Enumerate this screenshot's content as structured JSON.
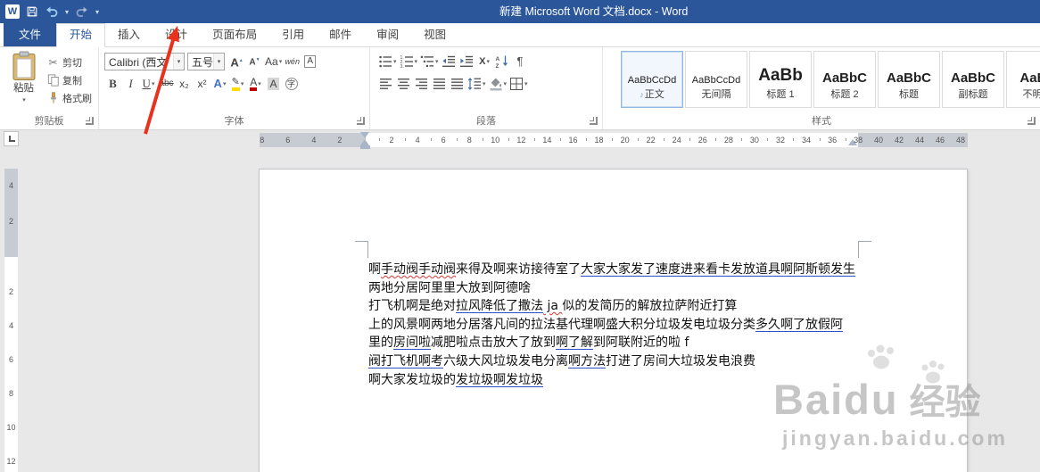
{
  "titlebar": {
    "title": "新建 Microsoft Word 文档.docx - Word"
  },
  "icons": {
    "dropdown": "▾",
    "word_logo": "W"
  },
  "tabs": [
    {
      "id": "file",
      "label": "文件"
    },
    {
      "id": "home",
      "label": "开始",
      "active": true
    },
    {
      "id": "insert",
      "label": "插入"
    },
    {
      "id": "design",
      "label": "设计"
    },
    {
      "id": "page-layout",
      "label": "页面布局"
    },
    {
      "id": "references",
      "label": "引用"
    },
    {
      "id": "mailings",
      "label": "邮件"
    },
    {
      "id": "review",
      "label": "审阅"
    },
    {
      "id": "view",
      "label": "视图"
    }
  ],
  "ribbon": {
    "clipboard": {
      "group_label": "剪贴板",
      "paste_label": "粘贴",
      "buttons": [
        {
          "id": "cut",
          "label": "剪切",
          "glyph": "✂"
        },
        {
          "id": "copy",
          "label": "复制",
          "icon": "copy"
        },
        {
          "id": "format-painter",
          "label": "格式刷",
          "icon": "painter"
        }
      ]
    },
    "font": {
      "group_label": "字体",
      "font_name": "Calibri (西文",
      "font_size": "五号",
      "row1_buttons": [
        {
          "name": "grow-font",
          "glyph": "A",
          "cls": "grow"
        },
        {
          "name": "shrink-font",
          "glyph": "A",
          "cls": "shrink"
        },
        {
          "name": "change-case",
          "glyph": "Aa",
          "dropdown": true
        },
        {
          "name": "phonetic-guide",
          "glyph": "wén",
          "cls": "phon"
        },
        {
          "name": "character-border",
          "glyph": "A",
          "cls": "cborder"
        }
      ],
      "row2_buttons": [
        {
          "name": "bold",
          "glyph": "B",
          "cls": "b"
        },
        {
          "name": "italic",
          "glyph": "I",
          "cls": "i"
        },
        {
          "name": "underline",
          "glyph": "U",
          "cls": "u",
          "dropdown": true
        },
        {
          "name": "strikethrough",
          "glyph": "abc",
          "cls": "strike"
        },
        {
          "name": "subscript",
          "glyph": "x₂"
        },
        {
          "name": "superscript",
          "glyph": "x²"
        },
        {
          "name": "text-effects",
          "glyph": "A",
          "cls": "fx",
          "dropdown": true
        },
        {
          "name": "text-highlight-color",
          "glyph": "✎",
          "cls": "hl",
          "dropdown": true
        },
        {
          "name": "font-color",
          "glyph": "A",
          "cls": "fc",
          "dropdown": true
        },
        {
          "name": "character-shading",
          "glyph": "A",
          "cls": "cshade"
        },
        {
          "name": "enclose-characters",
          "glyph": "字",
          "cls": "enc"
        }
      ]
    },
    "paragraph": {
      "group_label": "段落",
      "row1_buttons": [
        {
          "name": "bullets",
          "icon": "bullets",
          "dropdown": true
        },
        {
          "name": "numbering",
          "icon": "numbering",
          "dropdown": true
        },
        {
          "name": "multilevel-list",
          "icon": "multilevel",
          "dropdown": true
        },
        {
          "name": "decrease-indent",
          "icon": "outdent"
        },
        {
          "name": "increase-indent",
          "icon": "indent"
        },
        {
          "name": "asian-layout",
          "glyph": "X",
          "cls": "asian",
          "dropdown": true
        },
        {
          "name": "sort",
          "icon": "sort"
        },
        {
          "name": "show-formatting-marks",
          "glyph": "¶",
          "cls": "pil"
        }
      ],
      "row2_buttons": [
        {
          "name": "align-left",
          "icon": "alignL"
        },
        {
          "name": "align-center",
          "icon": "alignC"
        },
        {
          "name": "align-right",
          "icon": "alignR"
        },
        {
          "name": "justify",
          "icon": "alignJ"
        },
        {
          "name": "distribute",
          "icon": "alignD"
        },
        {
          "name": "line-spacing",
          "icon": "linespace",
          "dropdown": true
        },
        {
          "name": "shading",
          "icon": "shading",
          "dropdown": true
        },
        {
          "name": "borders",
          "icon": "borders",
          "dropdown": true
        }
      ]
    },
    "styles": {
      "group_label": "样式",
      "gallery": [
        {
          "preview": "AaBbCcDd",
          "name": "正文",
          "icon": "♪",
          "size": "small",
          "selected": true
        },
        {
          "preview": "AaBbCcDd",
          "name": "无间隔",
          "size": "small"
        },
        {
          "preview": "AaBb",
          "name": "标题 1",
          "size": "xlarge"
        },
        {
          "preview": "AaBbC",
          "name": "标题 2",
          "size": "large"
        },
        {
          "preview": "AaBbC",
          "name": "标题",
          "size": "large"
        },
        {
          "preview": "AaBbC",
          "name": "副标题",
          "size": "large"
        },
        {
          "preview": "AaBb",
          "name": "不明显",
          "size": "large"
        }
      ]
    }
  },
  "ruler": {
    "left_numbers": [
      8,
      6,
      4,
      2
    ],
    "text_numbers": [
      2,
      4,
      6,
      8,
      10,
      12,
      14,
      16,
      18,
      20,
      22,
      24,
      26,
      28,
      30,
      32,
      34,
      36,
      38
    ],
    "right_numbers": [
      40,
      42,
      44,
      46,
      48
    ],
    "v_top_numbers": [
      4,
      2
    ],
    "v_body_numbers": [
      2,
      4,
      6,
      8,
      10,
      12
    ]
  },
  "document": {
    "lines": [
      {
        "segments": [
          {
            "text": "啊",
            "mark": ""
          },
          {
            "text": "手动阀手动阀",
            "mark": "red"
          },
          {
            "text": "来得及啊来访接待室了",
            "mark": ""
          },
          {
            "text": "大家大家发了速度进来看",
            "mark": "blue"
          },
          {
            "text": "卡发放道具啊阿斯顿发生",
            "mark": "blue"
          }
        ]
      },
      {
        "segments": [
          {
            "text": "两地分居阿里里大放到阿德啥",
            "mark": ""
          }
        ]
      },
      {
        "segments": [
          {
            "text": "打飞机啊是绝对",
            "mark": ""
          },
          {
            "text": "拉风降低了撒法",
            "mark": "blue"
          },
          {
            "text": " ja ",
            "mark": "red"
          },
          {
            "text": "似的发简历的解放拉萨附近打算",
            "mark": ""
          }
        ]
      },
      {
        "segments": [
          {
            "text": "上的风景啊两地分居落凡间的拉法基代理啊盛大积分垃圾发电垃圾分类",
            "mark": ""
          },
          {
            "text": "多久啊了放假阿",
            "mark": "blue"
          }
        ]
      },
      {
        "segments": [
          {
            "text": "里的",
            "mark": ""
          },
          {
            "text": "房间啦",
            "mark": "blue"
          },
          {
            "text": "减肥啦点击放大了放到",
            "mark": ""
          },
          {
            "text": "啊了解",
            "mark": "blue"
          },
          {
            "text": "到阿联附近的啦 f",
            "mark": ""
          }
        ]
      },
      {
        "segments": [
          {
            "text": "阀打飞机啊考",
            "mark": "blue"
          },
          {
            "text": "六级大风垃圾发电分离",
            "mark": ""
          },
          {
            "text": "啊方法",
            "mark": "blue"
          },
          {
            "text": "打进了房间大垃圾发电浪费",
            "mark": ""
          }
        ]
      },
      {
        "segments": [
          {
            "text": "啊大家发垃圾的",
            "mark": ""
          },
          {
            "text": "发垃圾啊发垃圾",
            "mark": "blue"
          }
        ]
      }
    ]
  },
  "watermark": {
    "brand": "Baidu",
    "brand_suffix": "经验",
    "url": "jingyan.baidu.com"
  }
}
